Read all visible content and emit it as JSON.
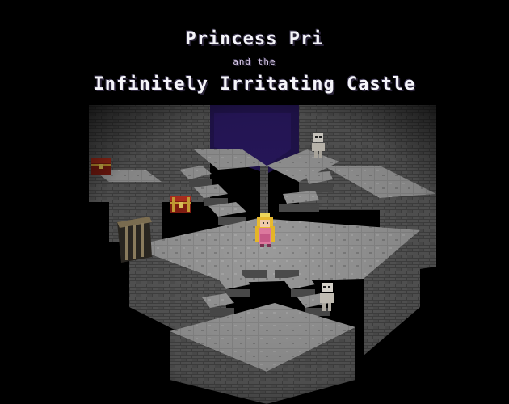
{
  "title": {
    "line1": "Princess Pri",
    "line2": "and the",
    "line3": "Infinitely Irritating Castle"
  },
  "colors": {
    "background": "#000000",
    "stone_top": "#8a8a8a",
    "stone_wall": "#4a4a4a",
    "water": "#2a1858",
    "title_text": "#f4f4f8"
  },
  "scene": {
    "characters": [
      "princess",
      "skeleton",
      "skeleton"
    ],
    "props": [
      "treasure-chest",
      "treasure-chest",
      "barred-gate"
    ]
  }
}
